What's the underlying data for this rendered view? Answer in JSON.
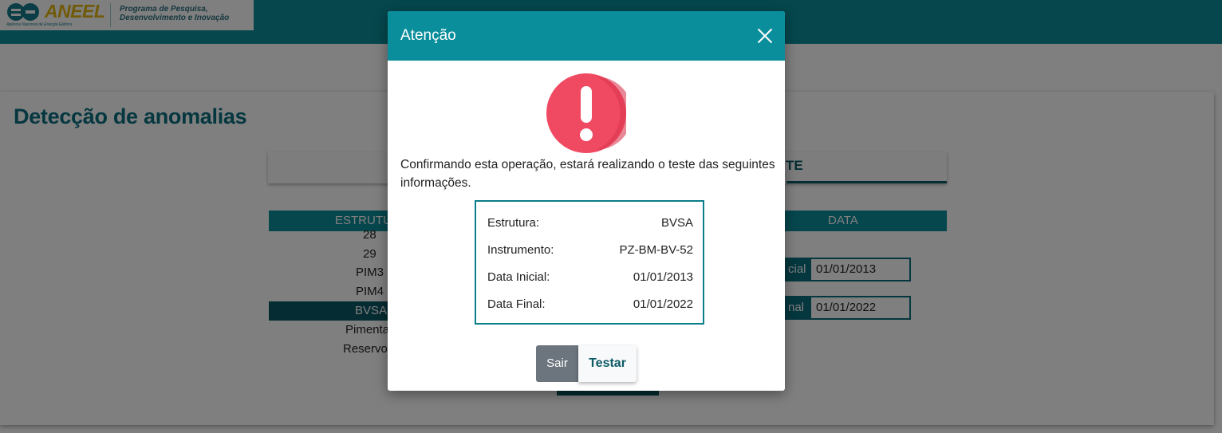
{
  "header": {
    "logo_text": "ANEEL",
    "logo_subtitle": "Agência Nacional de Energia Elétrica",
    "program_line1": "Programa de Pesquisa,",
    "program_line2": "Desenvolvimento e Inovação"
  },
  "page": {
    "title": "Detecção de anomalias",
    "active_tab_fragment": "TE",
    "table_headers": {
      "estrutura": "ESTRUTU",
      "data": "DATA"
    },
    "structures": [
      "28",
      "29",
      "PIM3",
      "PIM4",
      "BVSA",
      "Pimenta",
      "Reservo"
    ],
    "selected_structure": "BVSA",
    "date_initial_label": "cial",
    "date_initial_value": "01/01/2013",
    "date_final_label": "nal",
    "date_final_value": "01/01/2022"
  },
  "modal": {
    "title": "Atenção",
    "message": "Confirmando esta operação, estará realizando o teste das seguintes informações.",
    "fields": [
      {
        "label": "Estrutura:",
        "value": "BVSA"
      },
      {
        "label": "Instrumento:",
        "value": "PZ-BM-BV-52"
      },
      {
        "label": "Data Inicial:",
        "value": "01/01/2013"
      },
      {
        "label": "Data Final:",
        "value": "01/01/2022"
      }
    ],
    "cancel_label": "Sair",
    "confirm_label": "Testar",
    "icon": "exclamation-circle-icon",
    "icon_color": "#e8485f",
    "header_color": "#0b8e9b"
  }
}
